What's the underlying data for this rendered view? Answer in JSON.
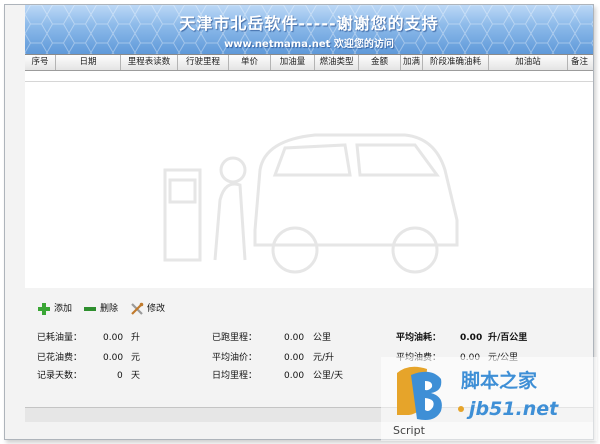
{
  "banner": {
    "title": "天津市北岳软件-----谢谢您的支持",
    "subtitle": "www.netmama.net 欢迎您的访问"
  },
  "grid": {
    "columns": [
      "序号",
      "日期",
      "里程表读数",
      "行驶里程",
      "单价",
      "加油量",
      "燃油类型",
      "金额",
      "加满",
      "阶段准确油耗",
      "加油站",
      "备注"
    ],
    "rows": []
  },
  "toolbar": {
    "add_label": "添加",
    "delete_label": "删除",
    "edit_label": "修改"
  },
  "stats": {
    "consumed_fuel": {
      "label": "已耗油量：",
      "value": "0.00",
      "unit": "升"
    },
    "spent_fuel_cost": {
      "label": "已花油费：",
      "value": "0.00",
      "unit": "元"
    },
    "record_days": {
      "label": "记录天数：",
      "value": "0",
      "unit": "天"
    },
    "distance_run": {
      "label": "已跑里程：",
      "value": "0.00",
      "unit": "公里"
    },
    "avg_fuel_price": {
      "label": "平均油价：",
      "value": "0.00",
      "unit": "元/升"
    },
    "daily_distance": {
      "label": "日均里程：",
      "value": "0.00",
      "unit": "公里/天"
    },
    "avg_fuel_consumption": {
      "label": "平均油耗：",
      "value": "0.00",
      "unit": "升/百公里"
    },
    "avg_fuel_cost": {
      "label": "平均油费：",
      "value": "0.00",
      "unit": "元/公里"
    }
  },
  "corner_logo": {
    "brand": "脚本之家",
    "url": "jb51.net",
    "script_word": "Script"
  },
  "colors": {
    "banner_top": "#bcd8f6",
    "banner_bottom": "#5f99d9",
    "add_icon": "#3aa635",
    "delete_icon": "#2f8f2f",
    "edit_icon": "#c07a2c",
    "logo_blue": "#3e8fd6",
    "logo_orange": "#e6a42a"
  }
}
